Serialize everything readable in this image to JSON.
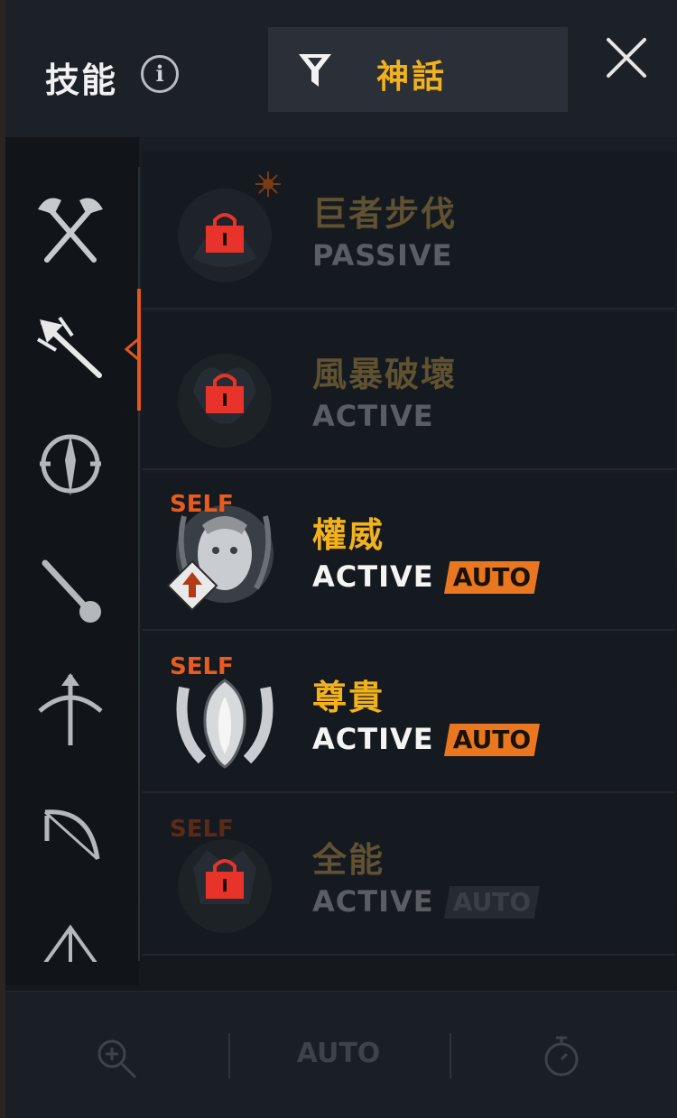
{
  "header": {
    "title": "技能",
    "info_icon": "info-icon",
    "filter_label": "神話",
    "filter_icon": "filter-funnel-icon",
    "close_icon": "close-icon"
  },
  "categories": [
    {
      "icon": "crossed-axes-icon",
      "active": false
    },
    {
      "icon": "trident-icon",
      "active": true
    },
    {
      "icon": "dagger-sigil-icon",
      "active": false
    },
    {
      "icon": "mace-icon",
      "active": false
    },
    {
      "icon": "crossbow-arrow-icon",
      "active": false
    },
    {
      "icon": "crossbow-icon",
      "active": false
    },
    {
      "icon": "crystal-orb-icon",
      "active": false
    }
  ],
  "skills": [
    {
      "name": "巨者步伐",
      "type": "PASSIVE",
      "self": "",
      "auto": "",
      "locked": true
    },
    {
      "name": "風暴破壞",
      "type": "ACTIVE",
      "self": "",
      "auto": "",
      "locked": true
    },
    {
      "name": "權威",
      "type": "ACTIVE",
      "self": "SELF",
      "auto": "AUTO",
      "locked": false
    },
    {
      "name": "尊貴",
      "type": "ACTIVE",
      "self": "SELF",
      "auto": "AUTO",
      "locked": false
    },
    {
      "name": "全能",
      "type": "ACTIVE",
      "self": "SELF",
      "auto": "AUTO",
      "locked": true
    }
  ],
  "bottom_bar": {
    "zoom_icon": "zoom-in-icon",
    "auto_label": "AUTO",
    "timer_icon": "stopwatch-icon"
  },
  "colors": {
    "accent_gold": "#f3b21c",
    "accent_orange": "#e8771f",
    "lock_red": "#e8332a",
    "self_orange": "#e95b1e"
  }
}
